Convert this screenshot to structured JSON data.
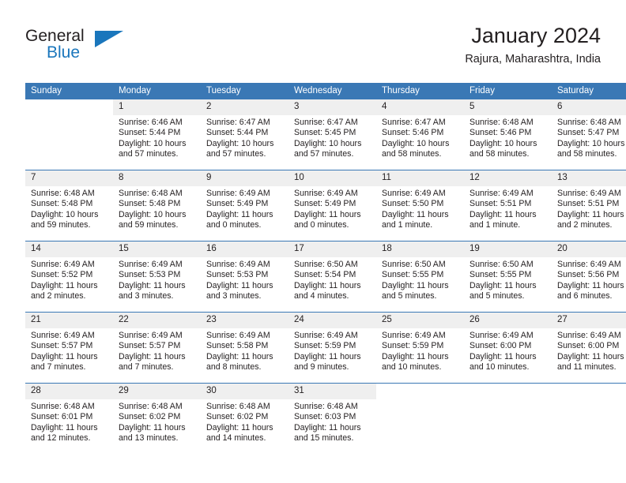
{
  "brand": {
    "name_part1": "General",
    "name_part2": "Blue",
    "accent_color": "#1a76bc"
  },
  "header": {
    "title": "January 2024",
    "subtitle": "Rajura, Maharashtra, India",
    "header_bg": "#3a78b5",
    "daynum_bg": "#efefef"
  },
  "weekday_headers": [
    "Sunday",
    "Monday",
    "Tuesday",
    "Wednesday",
    "Thursday",
    "Friday",
    "Saturday"
  ],
  "labels": {
    "sunrise_prefix": "Sunrise:",
    "sunset_prefix": "Sunset:",
    "daylight_prefix": "Daylight:"
  },
  "weeks": [
    [
      {
        "day": "",
        "sunrise": "",
        "sunset": "",
        "daylight_line1": "",
        "daylight_line2": ""
      },
      {
        "day": "1",
        "sunrise": "Sunrise: 6:46 AM",
        "sunset": "Sunset: 5:44 PM",
        "daylight_line1": "Daylight: 10 hours",
        "daylight_line2": "and 57 minutes."
      },
      {
        "day": "2",
        "sunrise": "Sunrise: 6:47 AM",
        "sunset": "Sunset: 5:44 PM",
        "daylight_line1": "Daylight: 10 hours",
        "daylight_line2": "and 57 minutes."
      },
      {
        "day": "3",
        "sunrise": "Sunrise: 6:47 AM",
        "sunset": "Sunset: 5:45 PM",
        "daylight_line1": "Daylight: 10 hours",
        "daylight_line2": "and 57 minutes."
      },
      {
        "day": "4",
        "sunrise": "Sunrise: 6:47 AM",
        "sunset": "Sunset: 5:46 PM",
        "daylight_line1": "Daylight: 10 hours",
        "daylight_line2": "and 58 minutes."
      },
      {
        "day": "5",
        "sunrise": "Sunrise: 6:48 AM",
        "sunset": "Sunset: 5:46 PM",
        "daylight_line1": "Daylight: 10 hours",
        "daylight_line2": "and 58 minutes."
      },
      {
        "day": "6",
        "sunrise": "Sunrise: 6:48 AM",
        "sunset": "Sunset: 5:47 PM",
        "daylight_line1": "Daylight: 10 hours",
        "daylight_line2": "and 58 minutes."
      }
    ],
    [
      {
        "day": "7",
        "sunrise": "Sunrise: 6:48 AM",
        "sunset": "Sunset: 5:48 PM",
        "daylight_line1": "Daylight: 10 hours",
        "daylight_line2": "and 59 minutes."
      },
      {
        "day": "8",
        "sunrise": "Sunrise: 6:48 AM",
        "sunset": "Sunset: 5:48 PM",
        "daylight_line1": "Daylight: 10 hours",
        "daylight_line2": "and 59 minutes."
      },
      {
        "day": "9",
        "sunrise": "Sunrise: 6:49 AM",
        "sunset": "Sunset: 5:49 PM",
        "daylight_line1": "Daylight: 11 hours",
        "daylight_line2": "and 0 minutes."
      },
      {
        "day": "10",
        "sunrise": "Sunrise: 6:49 AM",
        "sunset": "Sunset: 5:49 PM",
        "daylight_line1": "Daylight: 11 hours",
        "daylight_line2": "and 0 minutes."
      },
      {
        "day": "11",
        "sunrise": "Sunrise: 6:49 AM",
        "sunset": "Sunset: 5:50 PM",
        "daylight_line1": "Daylight: 11 hours",
        "daylight_line2": "and 1 minute."
      },
      {
        "day": "12",
        "sunrise": "Sunrise: 6:49 AM",
        "sunset": "Sunset: 5:51 PM",
        "daylight_line1": "Daylight: 11 hours",
        "daylight_line2": "and 1 minute."
      },
      {
        "day": "13",
        "sunrise": "Sunrise: 6:49 AM",
        "sunset": "Sunset: 5:51 PM",
        "daylight_line1": "Daylight: 11 hours",
        "daylight_line2": "and 2 minutes."
      }
    ],
    [
      {
        "day": "14",
        "sunrise": "Sunrise: 6:49 AM",
        "sunset": "Sunset: 5:52 PM",
        "daylight_line1": "Daylight: 11 hours",
        "daylight_line2": "and 2 minutes."
      },
      {
        "day": "15",
        "sunrise": "Sunrise: 6:49 AM",
        "sunset": "Sunset: 5:53 PM",
        "daylight_line1": "Daylight: 11 hours",
        "daylight_line2": "and 3 minutes."
      },
      {
        "day": "16",
        "sunrise": "Sunrise: 6:49 AM",
        "sunset": "Sunset: 5:53 PM",
        "daylight_line1": "Daylight: 11 hours",
        "daylight_line2": "and 3 minutes."
      },
      {
        "day": "17",
        "sunrise": "Sunrise: 6:50 AM",
        "sunset": "Sunset: 5:54 PM",
        "daylight_line1": "Daylight: 11 hours",
        "daylight_line2": "and 4 minutes."
      },
      {
        "day": "18",
        "sunrise": "Sunrise: 6:50 AM",
        "sunset": "Sunset: 5:55 PM",
        "daylight_line1": "Daylight: 11 hours",
        "daylight_line2": "and 5 minutes."
      },
      {
        "day": "19",
        "sunrise": "Sunrise: 6:50 AM",
        "sunset": "Sunset: 5:55 PM",
        "daylight_line1": "Daylight: 11 hours",
        "daylight_line2": "and 5 minutes."
      },
      {
        "day": "20",
        "sunrise": "Sunrise: 6:49 AM",
        "sunset": "Sunset: 5:56 PM",
        "daylight_line1": "Daylight: 11 hours",
        "daylight_line2": "and 6 minutes."
      }
    ],
    [
      {
        "day": "21",
        "sunrise": "Sunrise: 6:49 AM",
        "sunset": "Sunset: 5:57 PM",
        "daylight_line1": "Daylight: 11 hours",
        "daylight_line2": "and 7 minutes."
      },
      {
        "day": "22",
        "sunrise": "Sunrise: 6:49 AM",
        "sunset": "Sunset: 5:57 PM",
        "daylight_line1": "Daylight: 11 hours",
        "daylight_line2": "and 7 minutes."
      },
      {
        "day": "23",
        "sunrise": "Sunrise: 6:49 AM",
        "sunset": "Sunset: 5:58 PM",
        "daylight_line1": "Daylight: 11 hours",
        "daylight_line2": "and 8 minutes."
      },
      {
        "day": "24",
        "sunrise": "Sunrise: 6:49 AM",
        "sunset": "Sunset: 5:59 PM",
        "daylight_line1": "Daylight: 11 hours",
        "daylight_line2": "and 9 minutes."
      },
      {
        "day": "25",
        "sunrise": "Sunrise: 6:49 AM",
        "sunset": "Sunset: 5:59 PM",
        "daylight_line1": "Daylight: 11 hours",
        "daylight_line2": "and 10 minutes."
      },
      {
        "day": "26",
        "sunrise": "Sunrise: 6:49 AM",
        "sunset": "Sunset: 6:00 PM",
        "daylight_line1": "Daylight: 11 hours",
        "daylight_line2": "and 10 minutes."
      },
      {
        "day": "27",
        "sunrise": "Sunrise: 6:49 AM",
        "sunset": "Sunset: 6:00 PM",
        "daylight_line1": "Daylight: 11 hours",
        "daylight_line2": "and 11 minutes."
      }
    ],
    [
      {
        "day": "28",
        "sunrise": "Sunrise: 6:48 AM",
        "sunset": "Sunset: 6:01 PM",
        "daylight_line1": "Daylight: 11 hours",
        "daylight_line2": "and 12 minutes."
      },
      {
        "day": "29",
        "sunrise": "Sunrise: 6:48 AM",
        "sunset": "Sunset: 6:02 PM",
        "daylight_line1": "Daylight: 11 hours",
        "daylight_line2": "and 13 minutes."
      },
      {
        "day": "30",
        "sunrise": "Sunrise: 6:48 AM",
        "sunset": "Sunset: 6:02 PM",
        "daylight_line1": "Daylight: 11 hours",
        "daylight_line2": "and 14 minutes."
      },
      {
        "day": "31",
        "sunrise": "Sunrise: 6:48 AM",
        "sunset": "Sunset: 6:03 PM",
        "daylight_line1": "Daylight: 11 hours",
        "daylight_line2": "and 15 minutes."
      },
      {
        "day": "",
        "sunrise": "",
        "sunset": "",
        "daylight_line1": "",
        "daylight_line2": ""
      },
      {
        "day": "",
        "sunrise": "",
        "sunset": "",
        "daylight_line1": "",
        "daylight_line2": ""
      },
      {
        "day": "",
        "sunrise": "",
        "sunset": "",
        "daylight_line1": "",
        "daylight_line2": ""
      }
    ]
  ]
}
